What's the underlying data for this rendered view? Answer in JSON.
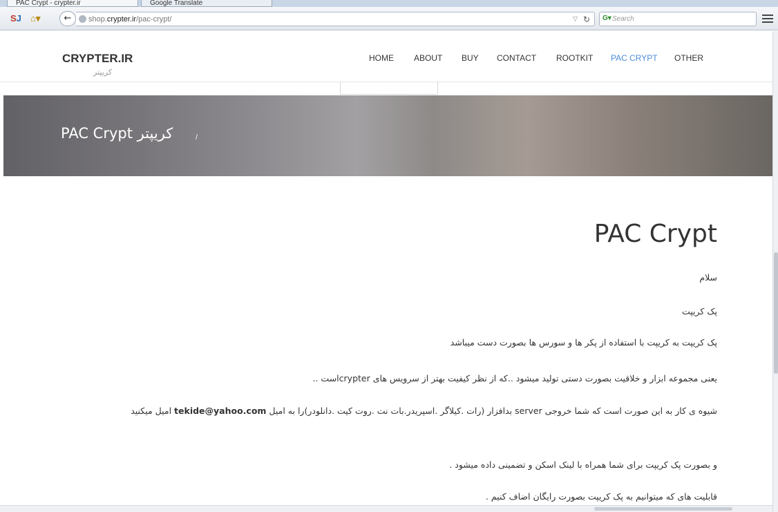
{
  "browser": {
    "tabs": [
      {
        "label": "PAC Crypt - crypter.ir",
        "active": true
      },
      {
        "label": "Google Translate",
        "active": false
      }
    ],
    "url": "shop.crypter.ir/pac-crypt/",
    "url_domain": "crypter.ir",
    "search_placeholder": "Search",
    "toolbar_icons": [
      "sitesearch-icon",
      "home-icon",
      "back-arrow-icon",
      "reload-icon",
      "menu-icon"
    ]
  },
  "site": {
    "brand": "CRYPTER.IR",
    "brand_sub": "کریپتر",
    "nav": [
      "HOME",
      "ABOUT",
      "BUY",
      "CONTACT",
      "ROOTKIT",
      "PAC CRYPT",
      "OTHER"
    ],
    "active_nav": "PAC CRYPT",
    "accent_color": "#4b8ed6"
  },
  "hero": {
    "breadcrumb_sep": "/",
    "title": "کریپتر PAC Crypt"
  },
  "content": {
    "title": "PAC Crypt",
    "paragraphs": [
      "سلام",
      "پک کریپت",
      "پک کریپت به کریپت با استفاده از پکر ها و سورس ها بصورت دست میباشد",
      "یعنی مجموعه ابزار و خلاقیت بصورت دستی تولید میشود ..که از نظر کیفیت بهتر از سرویس های crypterاست ..",
      "شیوه ی کار به این صورت است که شما خروجی server بدافزار (رات .کیلاگر .اسپریدر.بات نت .روت کیت .دانلودر)را به امیل tekide@yahoo.com امیل میکنید",
      "و بصورت پک کریپت برای شما همراه با لینک اسکن و تضمینی داده میشود .",
      "قابلیت های که میتوانیم به پک کریپت بصورت رایگان اضاف کنیم ."
    ]
  }
}
